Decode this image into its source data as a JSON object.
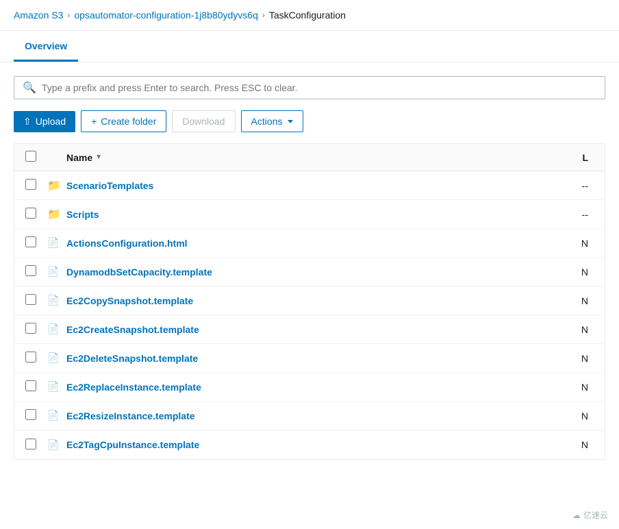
{
  "breadcrumb": {
    "home": "Amazon S3",
    "bucket": "opsautomator-configuration-1j8b80ydyvs6q",
    "folder": "TaskConfiguration"
  },
  "tabs": [
    {
      "label": "Overview",
      "active": true
    }
  ],
  "search": {
    "placeholder": "Type a prefix and press Enter to search. Press ESC to clear."
  },
  "toolbar": {
    "upload_label": "Upload",
    "create_folder_label": "Create folder",
    "download_label": "Download",
    "actions_label": "Actions"
  },
  "table": {
    "col_name": "Name",
    "col_last": "L",
    "items": [
      {
        "type": "folder",
        "name": "ScenarioTemplates",
        "last": "--"
      },
      {
        "type": "folder",
        "name": "Scripts",
        "last": "--"
      },
      {
        "type": "file-html",
        "name": "ActionsConfiguration.html",
        "last": "N"
      },
      {
        "type": "file",
        "name": "DynamodbSetCapacity.template",
        "last": "N"
      },
      {
        "type": "file",
        "name": "Ec2CopySnapshot.template",
        "last": "N"
      },
      {
        "type": "file",
        "name": "Ec2CreateSnapshot.template",
        "last": "N"
      },
      {
        "type": "file",
        "name": "Ec2DeleteSnapshot.template",
        "last": "N"
      },
      {
        "type": "file",
        "name": "Ec2ReplaceInstance.template",
        "last": "N"
      },
      {
        "type": "file",
        "name": "Ec2ResizeInstance.template",
        "last": "N"
      },
      {
        "type": "file",
        "name": "Ec2TagCpuInstance.template",
        "last": "N"
      }
    ]
  },
  "watermark": {
    "text": "亿速云"
  }
}
